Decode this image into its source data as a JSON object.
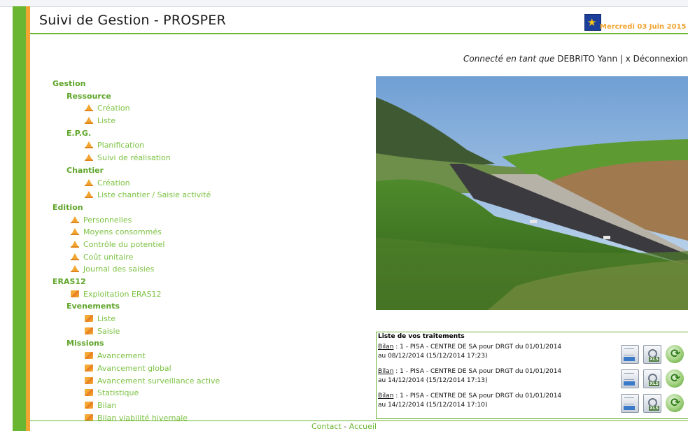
{
  "header": {
    "title": "Suivi de Gestion - PROSPER",
    "date": "Mercredi 03 Juin 2015"
  },
  "user": {
    "prefix": "Connecté en tant que",
    "name": "DEBRITO Yann",
    "separator": "|",
    "logout": "x Déconnexion"
  },
  "menu": [
    {
      "label": "Gestion",
      "type": "l0"
    },
    {
      "label": "Ressource",
      "type": "l1"
    },
    {
      "label": "Création",
      "type": "item",
      "indent": 2,
      "icon": "warning-triangle-icon"
    },
    {
      "label": "Liste",
      "type": "item",
      "indent": 2,
      "icon": "warning-triangle-icon"
    },
    {
      "label": "E.P.G.",
      "type": "l1"
    },
    {
      "label": "Planification",
      "type": "item",
      "indent": 2,
      "icon": "warning-triangle-icon"
    },
    {
      "label": "Suivi de réalisation",
      "type": "item",
      "indent": 2,
      "icon": "warning-triangle-icon"
    },
    {
      "label": "Chantier",
      "type": "l1"
    },
    {
      "label": "Création",
      "type": "item",
      "indent": 2,
      "icon": "warning-triangle-icon"
    },
    {
      "label": "Liste chantier / Saisie activité",
      "type": "item",
      "indent": 2,
      "icon": "warning-triangle-icon"
    },
    {
      "label": "Edition",
      "type": "l0"
    },
    {
      "label": "Personnelles",
      "type": "item",
      "indent": 1,
      "icon": "warning-triangle-icon"
    },
    {
      "label": "Moyens consommés",
      "type": "item",
      "indent": 1,
      "icon": "warning-triangle-icon"
    },
    {
      "label": "Contrôle du potentiel",
      "type": "item",
      "indent": 1,
      "icon": "warning-triangle-icon"
    },
    {
      "label": "Coût unitaire",
      "type": "item",
      "indent": 1,
      "icon": "warning-triangle-icon"
    },
    {
      "label": "Journal des saisies",
      "type": "item",
      "indent": 1,
      "icon": "warning-triangle-icon"
    },
    {
      "label": "ERAS12",
      "type": "l0"
    },
    {
      "label": "Exploitation ERAS12",
      "type": "item",
      "indent": 1,
      "icon": "road-flag-icon"
    },
    {
      "label": "Evenements",
      "type": "l1"
    },
    {
      "label": "Liste",
      "type": "item",
      "indent": 2,
      "icon": "road-flag-icon"
    },
    {
      "label": "Saisie",
      "type": "item",
      "indent": 2,
      "icon": "road-flag-icon"
    },
    {
      "label": "Missions",
      "type": "l1"
    },
    {
      "label": "Avancement",
      "type": "item",
      "indent": 2,
      "icon": "road-flag-icon"
    },
    {
      "label": "Avancement global",
      "type": "item",
      "indent": 2,
      "icon": "road-flag-icon"
    },
    {
      "label": "Avancement surveillance active",
      "type": "item",
      "indent": 2,
      "icon": "road-flag-icon"
    },
    {
      "label": "Statistique",
      "type": "item",
      "indent": 2,
      "icon": "road-flag-icon"
    },
    {
      "label": "Bilan",
      "type": "item",
      "indent": 2,
      "icon": "road-flag-icon"
    },
    {
      "label": "Bilan viabilité hivernale",
      "type": "item",
      "indent": 2,
      "icon": "road-flag-icon"
    }
  ],
  "treatments": {
    "title": "Liste de vos traitements",
    "rows": [
      {
        "link": "Bilan",
        "line1": " : 1 - PISA - CENTRE DE SA pour DRGT du 01/01/2014",
        "line2": "au 08/12/2014 (15/12/2014 17:23)"
      },
      {
        "link": "Bilan",
        "line1": " : 1 - PISA - CENTRE DE SA pour DRGT du 01/01/2014",
        "line2": "au 14/12/2014 (15/12/2014 17:13)"
      },
      {
        "link": "Bilan",
        "line1": " : 1 - PISA - CENTRE DE SA pour DRGT du 01/01/2014",
        "line2": "au 14/12/2014 (15/12/2014 17:10)"
      }
    ]
  },
  "footer": {
    "contact": "Contact",
    "separator": "-",
    "home": "Accueil"
  }
}
